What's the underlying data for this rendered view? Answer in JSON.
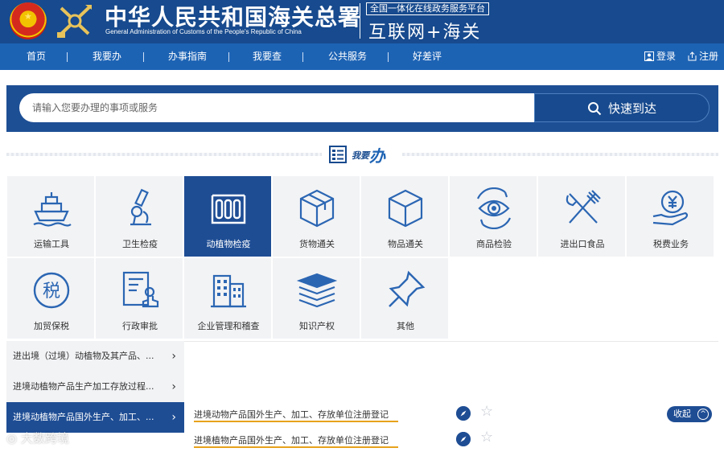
{
  "header": {
    "title": "中华人民共和国海关总署",
    "subtitle": "General Administration of Customs of the People's Republic of China",
    "platform_tag": "全国一体化在线政务服务平台",
    "platform_name": "互联网+海关"
  },
  "nav": {
    "items": [
      "首页",
      "我要办",
      "办事指南",
      "我要查",
      "公共服务",
      "好差评"
    ],
    "login": "登录",
    "register": "注册"
  },
  "search": {
    "placeholder": "请输入您要办理的事项或服务",
    "button": "快速到达"
  },
  "section": {
    "title_small": "我要",
    "title_big": "办"
  },
  "tiles": [
    {
      "label": "运输工具",
      "icon": "ship-icon"
    },
    {
      "label": "卫生检疫",
      "icon": "microscope-icon"
    },
    {
      "label": "动植物检疫",
      "icon": "test-tubes-icon",
      "active": true
    },
    {
      "label": "货物通关",
      "icon": "box-icon"
    },
    {
      "label": "物品通关",
      "icon": "package-icon"
    },
    {
      "label": "商品检验",
      "icon": "eye-inspect-icon"
    },
    {
      "label": "进出口食品",
      "icon": "fork-knife-icon"
    },
    {
      "label": "税费业务",
      "icon": "yen-hand-icon"
    },
    {
      "label": "加贸保税",
      "icon": "tax-icon"
    },
    {
      "label": "行政审批",
      "icon": "approval-stamp-icon"
    },
    {
      "label": "企业管理和稽查",
      "icon": "building-icon"
    },
    {
      "label": "知识产权",
      "icon": "books-icon"
    },
    {
      "label": "其他",
      "icon": "pin-icon"
    }
  ],
  "sublist": [
    "进出境（过境）动植物及其产品、...",
    "进境动植物产品生产加工存放过程...",
    "进境动植物产品国外生产、加工、..."
  ],
  "services": [
    "进境动物产品国外生产、加工、存放单位注册登记",
    "进境植物产品国外生产、加工、存放单位注册登记"
  ],
  "collapse": "收起",
  "watermark": "大数跨境",
  "colors": {
    "header_bg": "#174a8e",
    "nav_bg": "#1d63b4",
    "active_tile": "#1e4d94",
    "icon_blue": "#2b66b3",
    "underline": "#e7a21b"
  }
}
